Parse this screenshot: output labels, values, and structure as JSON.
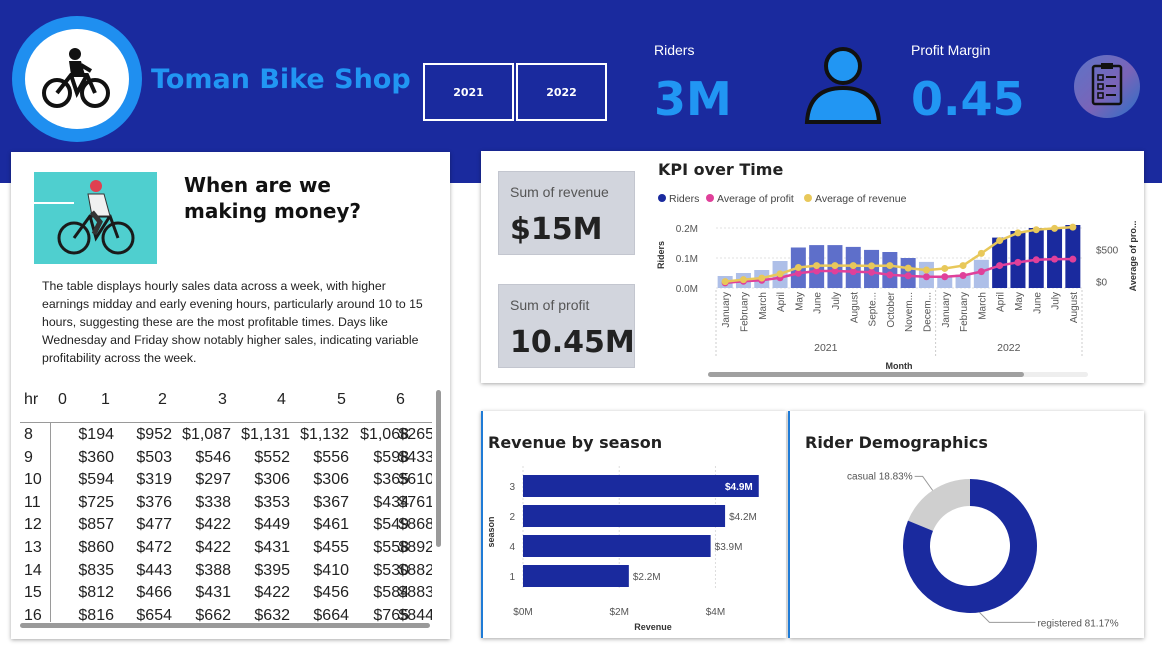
{
  "header": {
    "brand": "Toman Bike Shop",
    "years": [
      "2021",
      "2022"
    ],
    "riders_label": "Riders",
    "riders_value": "3M",
    "profit_margin_label": "Profit Margin",
    "profit_margin_value": "0.45",
    "logo_icon": "cyclist-icon",
    "rider_icon": "person-icon",
    "report_icon": "clipboard-icon",
    "colors": {
      "band": "#1a2a9e",
      "accent": "#2196f3"
    }
  },
  "insight": {
    "title": "When are we making money?",
    "description": "The table displays hourly sales data across a week, with higher earnings midday and early evening hours, particularly around 10 to 15 hours, suggesting these are the most profitable times. Days like Wednesday and Friday show notably higher sales, indicating variable profitability across the week.",
    "image_icon": "cyclist-illustration"
  },
  "hourly_table": {
    "header_label": "hr",
    "days": [
      "0",
      "1",
      "2",
      "3",
      "4",
      "5",
      "6"
    ],
    "rows": [
      {
        "hr": "8",
        "vals": [
          "$194",
          "$952",
          "$1,087",
          "$1,131",
          "$1,132",
          "$1,068",
          "$265"
        ]
      },
      {
        "hr": "9",
        "vals": [
          "$360",
          "$503",
          "$546",
          "$552",
          "$556",
          "$598",
          "$433"
        ]
      },
      {
        "hr": "10",
        "vals": [
          "$594",
          "$319",
          "$297",
          "$306",
          "$306",
          "$365",
          "$610"
        ]
      },
      {
        "hr": "11",
        "vals": [
          "$725",
          "$376",
          "$338",
          "$353",
          "$367",
          "$434",
          "$761"
        ]
      },
      {
        "hr": "12",
        "vals": [
          "$857",
          "$477",
          "$422",
          "$449",
          "$461",
          "$549",
          "$868"
        ]
      },
      {
        "hr": "13",
        "vals": [
          "$860",
          "$472",
          "$422",
          "$431",
          "$455",
          "$558",
          "$892"
        ]
      },
      {
        "hr": "14",
        "vals": [
          "$835",
          "$443",
          "$388",
          "$395",
          "$410",
          "$530",
          "$882"
        ]
      },
      {
        "hr": "15",
        "vals": [
          "$812",
          "$466",
          "$431",
          "$422",
          "$456",
          "$584",
          "$883"
        ]
      },
      {
        "hr": "16",
        "vals": [
          "$816",
          "$654",
          "$662",
          "$632",
          "$664",
          "$765",
          "$844"
        ]
      }
    ]
  },
  "kpis": {
    "revenue_label": "Sum of revenue",
    "revenue_value": "$15M",
    "profit_label": "Sum of profit",
    "profit_value": "10.45M"
  },
  "chart_data": [
    {
      "type": "bar",
      "title": "KPI over Time",
      "legend": [
        "Riders",
        "Average of profit",
        "Average of revenue"
      ],
      "legend_position": "top-left",
      "xlabel": "Month",
      "ylabel": "Riders",
      "y2label": "Average of pro...",
      "years": [
        "2021",
        "2022"
      ],
      "categories": [
        "January",
        "February",
        "March",
        "April",
        "May",
        "June",
        "July",
        "August",
        "Septe...",
        "October",
        "Novem...",
        "Decem...",
        "January",
        "February",
        "March",
        "April",
        "May",
        "June",
        "July",
        "August"
      ],
      "year_of_category": [
        "2021",
        "2021",
        "2021",
        "2021",
        "2021",
        "2021",
        "2021",
        "2021",
        "2021",
        "2021",
        "2021",
        "2021",
        "2022",
        "2022",
        "2022",
        "2022",
        "2022",
        "2022",
        "2022",
        "2022"
      ],
      "y_ticks": [
        "0.0M",
        "0.1M",
        "0.2M"
      ],
      "y2_ticks": [
        "$0",
        "$500"
      ],
      "ylim": [
        0,
        0.22
      ],
      "y2lim": [
        -100,
        930
      ],
      "series": [
        {
          "name": "Riders",
          "kind": "bar",
          "color": "#1a2a9e",
          "values": [
            0.04,
            0.05,
            0.06,
            0.09,
            0.135,
            0.143,
            0.143,
            0.137,
            0.127,
            0.12,
            0.1,
            0.087,
            0.038,
            0.045,
            0.094,
            0.168,
            0.19,
            0.2,
            0.2,
            0.21
          ]
        },
        {
          "name": "Average of profit",
          "kind": "line",
          "color": "#e0409a",
          "values": [
            -20,
            5,
            20,
            60,
            130,
            165,
            165,
            155,
            145,
            105,
            90,
            75,
            75,
            95,
            155,
            250,
            300,
            340,
            350,
            350
          ]
        },
        {
          "name": "Average of revenue",
          "kind": "line",
          "color": "#e8c85a",
          "values": [
            0,
            30,
            55,
            120,
            220,
            250,
            250,
            250,
            245,
            250,
            210,
            180,
            205,
            250,
            440,
            640,
            760,
            810,
            830,
            850
          ]
        }
      ]
    },
    {
      "type": "bar",
      "orientation": "horizontal",
      "title": "Revenue by season",
      "xlabel": "Revenue",
      "ylabel": "season",
      "categories": [
        "3",
        "2",
        "4",
        "1"
      ],
      "values": [
        4.9,
        4.2,
        3.9,
        2.2
      ],
      "data_labels": [
        "$4.9M",
        "$4.2M",
        "$3.9M",
        "$2.2M"
      ],
      "x_ticks": [
        "$0M",
        "$2M",
        "$4M"
      ],
      "xlim": [
        0,
        5.3
      ],
      "color": "#1a2a9e"
    },
    {
      "type": "pie",
      "donut": true,
      "title": "Rider Demographics",
      "categories": [
        "registered",
        "casual"
      ],
      "values": [
        81.17,
        18.83
      ],
      "data_labels": [
        "registered 81.17%",
        "casual 18.83%"
      ],
      "colors": [
        "#1a2a9e",
        "#cfcfcf"
      ]
    }
  ]
}
